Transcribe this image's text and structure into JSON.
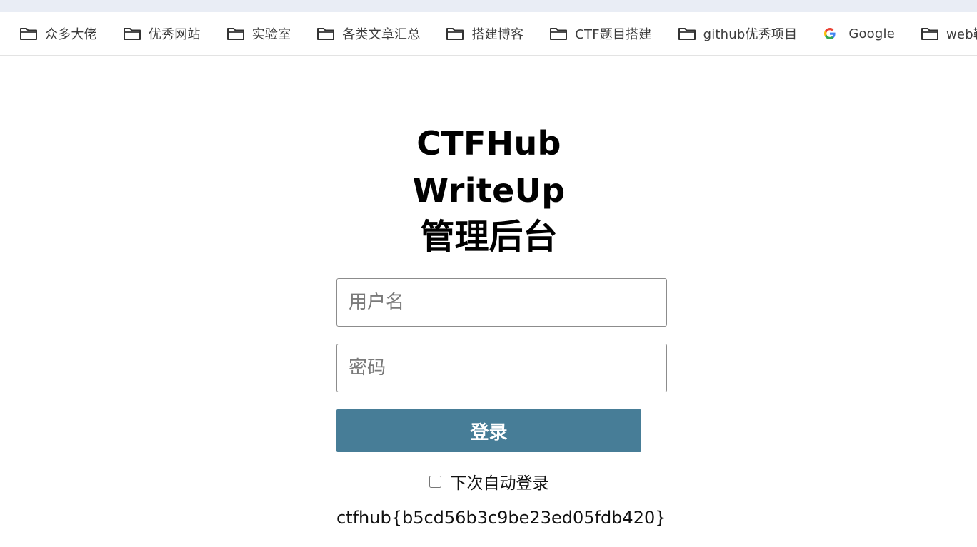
{
  "bookmarks": [
    {
      "label": "众多大佬",
      "icon": "folder-icon"
    },
    {
      "label": "优秀网站",
      "icon": "folder-icon"
    },
    {
      "label": "实验室",
      "icon": "folder-icon"
    },
    {
      "label": "各类文章汇总",
      "icon": "folder-icon"
    },
    {
      "label": "搭建博客",
      "icon": "folder-icon"
    },
    {
      "label": "CTF题目搭建",
      "icon": "folder-icon"
    },
    {
      "label": "github优秀项目",
      "icon": "folder-icon"
    },
    {
      "label": "Google",
      "icon": "google-icon"
    },
    {
      "label": "web靶场集",
      "icon": "folder-icon"
    }
  ],
  "page": {
    "title_line1": "CTFHub WriteUp",
    "title_line2": "管理后台"
  },
  "form": {
    "username_placeholder": "用户名",
    "password_placeholder": "密码",
    "login_label": "登录",
    "remember_label": "下次自动登录",
    "remember_checked": false
  },
  "flag_text": "ctfhub{b5cd56b3c9be23ed05fdb420}",
  "colors": {
    "login_button": "#477d97",
    "top_strip": "#e9edf5"
  }
}
